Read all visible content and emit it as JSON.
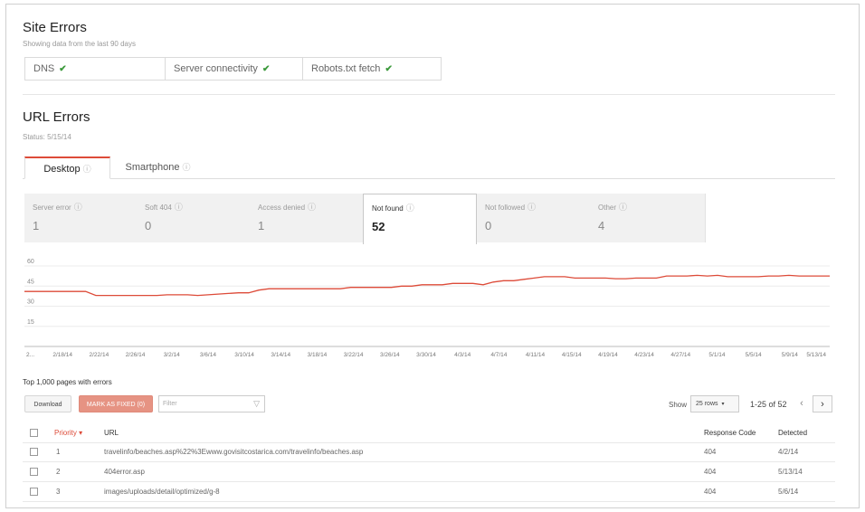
{
  "site_errors": {
    "title": "Site Errors",
    "subtitle": "Showing data from the last 90 days",
    "items": [
      {
        "label": "DNS",
        "icon": "check-icon"
      },
      {
        "label": "Server connectivity",
        "icon": "check-icon"
      },
      {
        "label": "Robots.txt fetch",
        "icon": "check-icon"
      }
    ]
  },
  "url_errors": {
    "title": "URL Errors",
    "status": "Status: 5/15/14"
  },
  "tabs": [
    {
      "label": "Desktop",
      "active": true
    },
    {
      "label": "Smartphone",
      "active": false
    }
  ],
  "categories": [
    {
      "label": "Server error",
      "value": "1",
      "active": false
    },
    {
      "label": "Soft 404",
      "value": "0",
      "active": false
    },
    {
      "label": "Access denied",
      "value": "1",
      "active": false
    },
    {
      "label": "Not found",
      "value": "52",
      "active": true
    },
    {
      "label": "Not followed",
      "value": "0",
      "active": false
    },
    {
      "label": "Other",
      "value": "4",
      "active": false
    }
  ],
  "chart_data": {
    "type": "line",
    "y_ticks": [
      "60",
      "45",
      "30",
      "15"
    ],
    "ylim": [
      0,
      60
    ],
    "grid": true,
    "color": "#dd4b39",
    "x_labels": [
      "2...",
      "2/18/14",
      "2/22/14",
      "2/26/14",
      "3/2/14",
      "3/6/14",
      "3/10/14",
      "3/14/14",
      "3/18/14",
      "3/22/14",
      "3/26/14",
      "3/30/14",
      "4/3/14",
      "4/7/14",
      "4/11/14",
      "4/15/14",
      "4/19/14",
      "4/23/14",
      "4/27/14",
      "5/1/14",
      "5/5/14",
      "5/9/14",
      "5/13/14"
    ],
    "values": [
      41,
      41,
      41,
      41,
      41,
      41,
      41,
      38,
      38,
      38,
      38,
      38,
      38,
      38,
      38.5,
      38.5,
      38.5,
      38,
      38.5,
      39,
      39.5,
      40,
      40,
      42,
      43,
      43,
      43,
      43,
      43,
      43,
      43,
      43,
      44,
      44,
      44,
      44,
      44,
      45,
      45,
      46,
      46,
      46,
      47,
      47,
      47,
      46,
      48,
      49,
      49,
      50,
      51,
      52,
      52,
      52,
      51,
      51,
      51,
      51,
      50.5,
      50.5,
      51,
      51,
      51,
      52.5,
      52.5,
      52.5,
      53,
      52.5,
      53,
      52,
      52,
      52,
      52,
      52.5,
      52.5,
      53,
      52.5,
      52.5,
      52.5,
      52.5
    ]
  },
  "table": {
    "caption": "Top 1,000 pages with errors",
    "download_label": "Download",
    "mark_fixed_label": "MARK AS FIXED (0)",
    "filter_placeholder": "Filter",
    "show_label": "Show",
    "rows_select": "25 rows",
    "range": "1-25 of 52",
    "headers": {
      "priority": "Priority",
      "sort_arrow": "▾",
      "url": "URL",
      "code": "Response Code",
      "detected": "Detected"
    },
    "rows": [
      {
        "priority": "1",
        "url": "travelinfo/beaches.asp%22%3Ewww.govisitcostarica.com/travelinfo/beaches.asp",
        "code": "404",
        "detected": "4/2/14"
      },
      {
        "priority": "2",
        "url": "404error.asp",
        "code": "404",
        "detected": "5/13/14"
      },
      {
        "priority": "3",
        "url": "images/uploads/detail/optimized/g-8",
        "code": "404",
        "detected": "5/6/14"
      }
    ]
  }
}
